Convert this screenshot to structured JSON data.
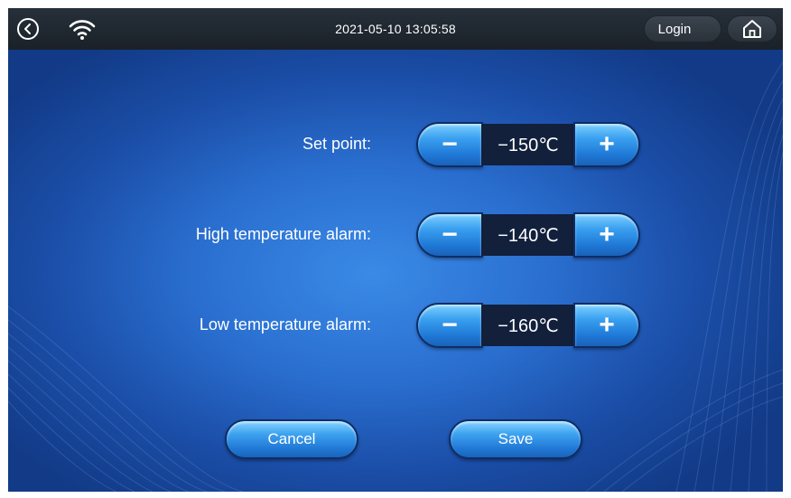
{
  "topbar": {
    "datetime": "2021-05-10 13:05:58",
    "login_label": "Login",
    "back_icon": "back-arrow-icon",
    "wifi_icon": "wifi-icon",
    "home_icon": "home-icon"
  },
  "settings": [
    {
      "label": "Set point:",
      "value": "−150℃"
    },
    {
      "label": "High temperature alarm:",
      "value": "−140℃"
    },
    {
      "label": "Low temperature alarm:",
      "value": "−160℃"
    }
  ],
  "stepper": {
    "minus_symbol": "−",
    "plus_symbol": "+"
  },
  "actions": {
    "cancel_label": "Cancel",
    "save_label": "Save"
  },
  "colors": {
    "background_center": "#3a8ae6",
    "background_edge": "#123a86",
    "topbar": "#1f272f",
    "button_light": "#7fd0ff",
    "button_dark": "#1a62b8",
    "value_box": "#12203c"
  }
}
